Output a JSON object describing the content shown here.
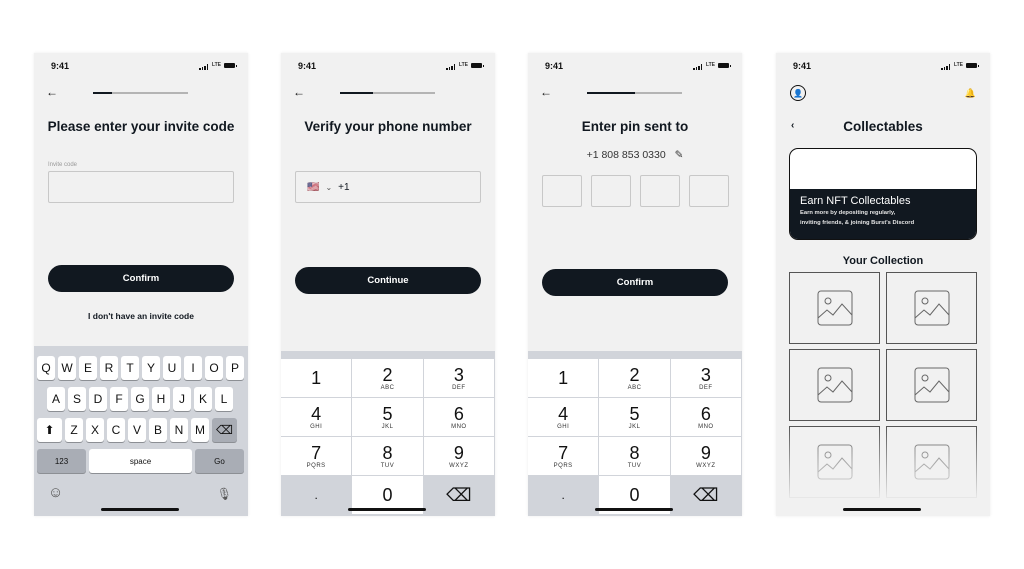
{
  "status": {
    "time": "9:41",
    "network": "LTE"
  },
  "screens": [
    {
      "progress": 0.2,
      "title": "Please enter your invite code",
      "field_label": "Invite code",
      "field_value": "",
      "button": "Confirm",
      "link": "I don't have an invite code",
      "keyboard": {
        "row1": [
          "Q",
          "W",
          "E",
          "R",
          "T",
          "Y",
          "U",
          "I",
          "O",
          "P"
        ],
        "row2": [
          "A",
          "S",
          "D",
          "F",
          "G",
          "H",
          "J",
          "K",
          "L"
        ],
        "row3": [
          "Z",
          "X",
          "C",
          "V",
          "B",
          "N",
          "M"
        ],
        "numbers": "123",
        "space": "space",
        "go": "Go"
      }
    },
    {
      "progress": 0.35,
      "title": "Verify your phone number",
      "country_flag": "🇺🇸",
      "country_code": "+1",
      "button": "Continue",
      "numpad": [
        {
          "n": "1",
          "l": ""
        },
        {
          "n": "2",
          "l": "ABC"
        },
        {
          "n": "3",
          "l": "DEF"
        },
        {
          "n": "4",
          "l": "GHI"
        },
        {
          "n": "5",
          "l": "JKL"
        },
        {
          "n": "6",
          "l": "MNO"
        },
        {
          "n": "7",
          "l": "PQRS"
        },
        {
          "n": "8",
          "l": "TUV"
        },
        {
          "n": "9",
          "l": "WXYZ"
        },
        {
          "n": ".",
          "l": ""
        },
        {
          "n": "0",
          "l": ""
        },
        {
          "n": "⌫",
          "l": ""
        }
      ]
    },
    {
      "progress": 0.5,
      "title": "Enter pin sent to",
      "phone": "+1 808 853 0330",
      "pins": [
        "",
        "",
        "",
        ""
      ],
      "button": "Confirm"
    },
    {
      "title": "Collectables",
      "banner": {
        "heading": "Earn NFT Collectables",
        "line1": "Earn more by depositing regularly,",
        "line2": "inviting friends, & joining Burst's Discord"
      },
      "collection_title": "Your Collection",
      "tiles": 6
    }
  ]
}
